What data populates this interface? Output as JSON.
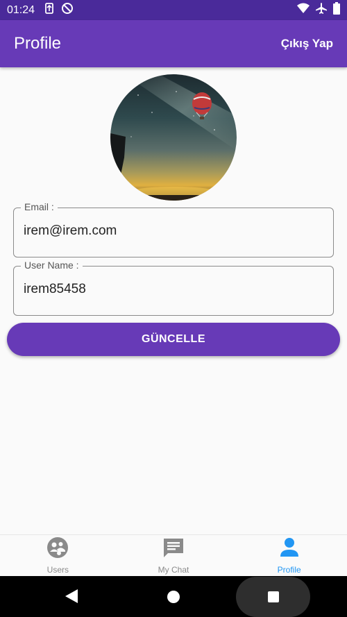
{
  "status_bar": {
    "time": "01:24",
    "left_icons": [
      "sync-icon",
      "do-not-disturb-icon"
    ],
    "right_icons": [
      "wifi-icon",
      "airplane-icon",
      "battery-icon"
    ]
  },
  "app_bar": {
    "title": "Profile",
    "logout_label": "Çıkış Yap",
    "color": "#673ab7"
  },
  "avatar": {
    "icon": "profile-photo-balloon-night-sky"
  },
  "form": {
    "email": {
      "label": "Email :",
      "value": "irem@irem.com"
    },
    "username": {
      "label": "User Name :",
      "value": "irem85458"
    },
    "update_label": "GÜNCELLE"
  },
  "bottom_nav": {
    "items": [
      {
        "label": "Users",
        "icon": "users-icon",
        "active": false
      },
      {
        "label": "My Chat",
        "icon": "chat-icon",
        "active": false
      },
      {
        "label": "Profile",
        "icon": "person-icon",
        "active": true
      }
    ],
    "active_color": "#2196f3",
    "inactive_color": "#8a8a8a"
  },
  "system_nav": {
    "buttons": [
      "back-icon",
      "home-icon",
      "recents-icon"
    ]
  }
}
